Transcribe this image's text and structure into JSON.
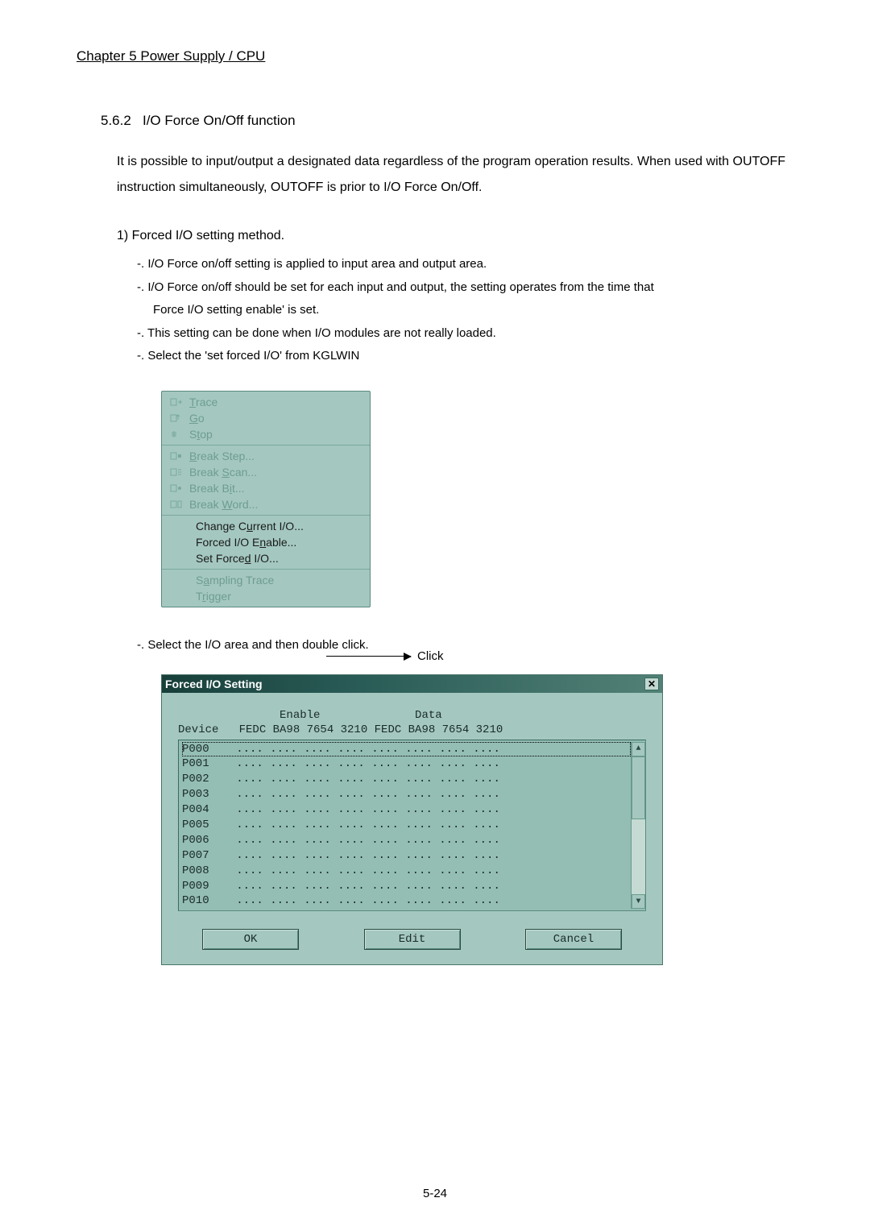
{
  "chapter": "Chapter 5    Power Supply / CPU",
  "section_number": "5.6.2",
  "section_title": "I/O Force  On/Off  function",
  "intro": "It is possible to input/output a designated data regardless of the program operation results. When used with OUTOFF instruction simultaneously, OUTOFF is prior to I/O Force On/Off.",
  "sub1": "1)  Forced  I/O setting  method.",
  "bullets": {
    "b1": "-. I/O Force  on/off  setting  is  applied  to  input  area  and  output  area.",
    "b2": "-. I/O Force  on/off  should  be  set  for  each  input  and  output,  the  setting  operates  from  the  time  that",
    "b2b": "Force  I/O setting  enable'  is  set.",
    "b3": "-. This  setting  can  be  done  when  I/O  modules  are  not  really  loaded.",
    "b4": "-. Select the    'set forced I/O' from KGLWIN"
  },
  "menu": {
    "trace": "Trace",
    "go": "Go",
    "stop": "Stop",
    "break_step": "Break Step...",
    "break_scan": "Break Scan...",
    "break_bit": "Break Bit...",
    "break_word": "Break Word...",
    "change_current": "Change Current I/O...",
    "forced_enable": "Forced I/O Enable...",
    "set_forced": "Set Forced I/O...",
    "sampling": "Sampling Trace",
    "trigger": "Trigger"
  },
  "click_label": "Click",
  "after_menu": "-. Select the I/O area and then double click.",
  "dialog": {
    "title": "Forced I/O Setting",
    "header1": "               Enable              Data",
    "header2": "Device   FEDC BA98 7654 3210 FEDC BA98 7654 3210",
    "rows": [
      {
        "dev": "P000",
        "dots": "    .... .... .... .... .... .... .... ....",
        "sel": true
      },
      {
        "dev": "P001",
        "dots": "    .... .... .... .... .... .... .... ....",
        "sel": false
      },
      {
        "dev": "P002",
        "dots": "    .... .... .... .... .... .... .... ....",
        "sel": false
      },
      {
        "dev": "P003",
        "dots": "    .... .... .... .... .... .... .... ....",
        "sel": false
      },
      {
        "dev": "P004",
        "dots": "    .... .... .... .... .... .... .... ....",
        "sel": false
      },
      {
        "dev": "P005",
        "dots": "    .... .... .... .... .... .... .... ....",
        "sel": false
      },
      {
        "dev": "P006",
        "dots": "    .... .... .... .... .... .... .... ....",
        "sel": false
      },
      {
        "dev": "P007",
        "dots": "    .... .... .... .... .... .... .... ....",
        "sel": false
      },
      {
        "dev": "P008",
        "dots": "    .... .... .... .... .... .... .... ....",
        "sel": false
      },
      {
        "dev": "P009",
        "dots": "    .... .... .... .... .... .... .... ....",
        "sel": false
      },
      {
        "dev": "P010",
        "dots": "    .... .... .... .... .... .... .... ....",
        "sel": false
      }
    ],
    "ok": "OK",
    "edit": "Edit",
    "cancel": "Cancel"
  },
  "page_number": "5-24"
}
